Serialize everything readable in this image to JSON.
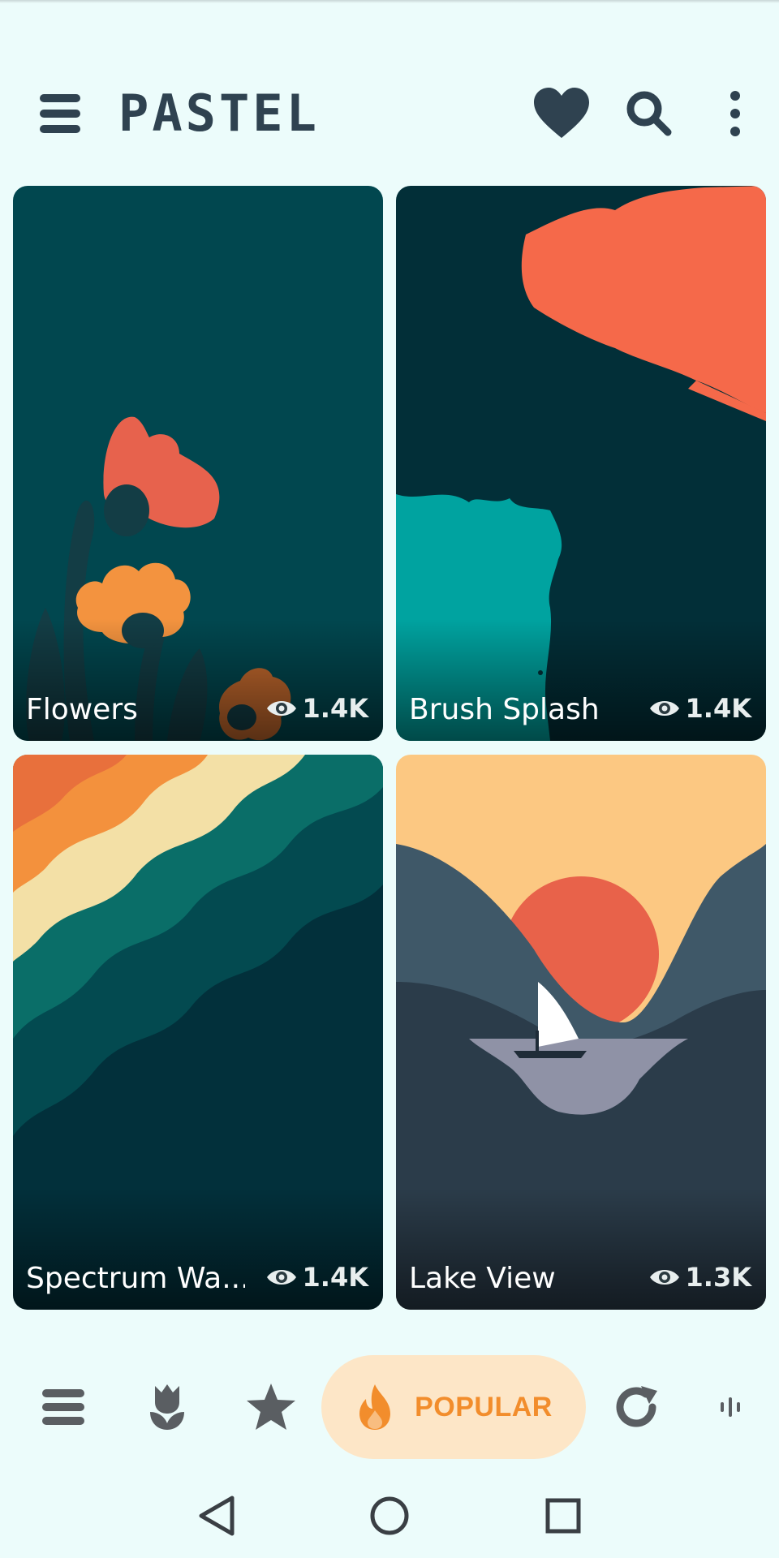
{
  "app": {
    "logo_text": "PASTEL"
  },
  "header": {
    "icons": [
      "menu-icon",
      "heart-icon",
      "search-icon",
      "more-vertical-icon"
    ]
  },
  "wallpapers": [
    {
      "title": "Flowers",
      "views": "1.4K"
    },
    {
      "title": "Brush Splash",
      "views": "1.4K"
    },
    {
      "title": "Spectrum Wa...",
      "views": "1.4K"
    },
    {
      "title": "Lake View",
      "views": "1.3K"
    }
  ],
  "bottom_nav": {
    "items": [
      "list-icon",
      "tulip-icon",
      "star-icon",
      "fire-icon",
      "refresh-icon",
      "equalizer-icon"
    ],
    "active_label": "POPULAR",
    "active_color": "#f28d2c",
    "active_bg": "#fde6c7"
  },
  "system_nav": [
    "back-icon",
    "home-icon",
    "recents-icon"
  ],
  "colors": {
    "background": "#ecfcfb",
    "icon": "#2f4250",
    "nav_icon": "#5a5e62"
  }
}
